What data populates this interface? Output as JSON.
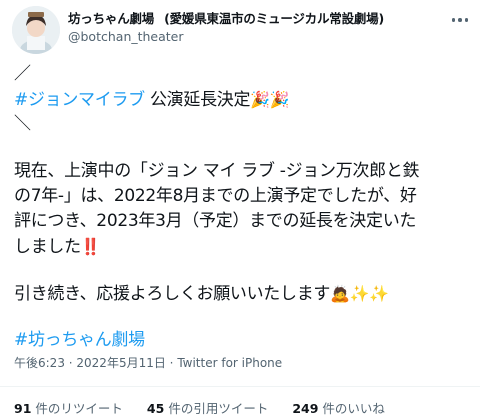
{
  "header": {
    "display_name": "坊っちゃん劇場",
    "subtitle": "(愛媛県東温市のミュージカル常設劇場)",
    "handle": "@botchan_theater"
  },
  "tweet": {
    "bracket_open": "／",
    "hashtag_1": "#ジョンマイラブ",
    "headline": " 公演延長決定",
    "emoji_party": "🎉🎉",
    "bracket_close": "＼",
    "line_1": "現在、上演中の「ジョン マイ ラブ -ジョン万次郎と鉄",
    "line_2": "の7年-」は、2022年8月までの上演予定でしたが、好",
    "line_3": "評につき、2023年3月（予定）までの延長を決定いた",
    "line_4": "しました",
    "emoji_exclaim": "‼️",
    "line_5": "引き続き、応援よろしくお願いいたします",
    "emoji_support": "🙇✨✨",
    "hashtag_2": "#坊っちゃん劇場"
  },
  "meta": {
    "time": "午後6:23",
    "date": "2022年5月11日",
    "client": "Twitter for iPhone"
  },
  "stats": {
    "retweets_count": "91",
    "retweets_label": "件のリツイート",
    "quotes_count": "45",
    "quotes_label": "件の引用ツイート",
    "likes_count": "249",
    "likes_label": "件のいいね"
  },
  "colors": {
    "link": "#1d9bf0",
    "text": "#0f1419",
    "muted": "#536471"
  }
}
